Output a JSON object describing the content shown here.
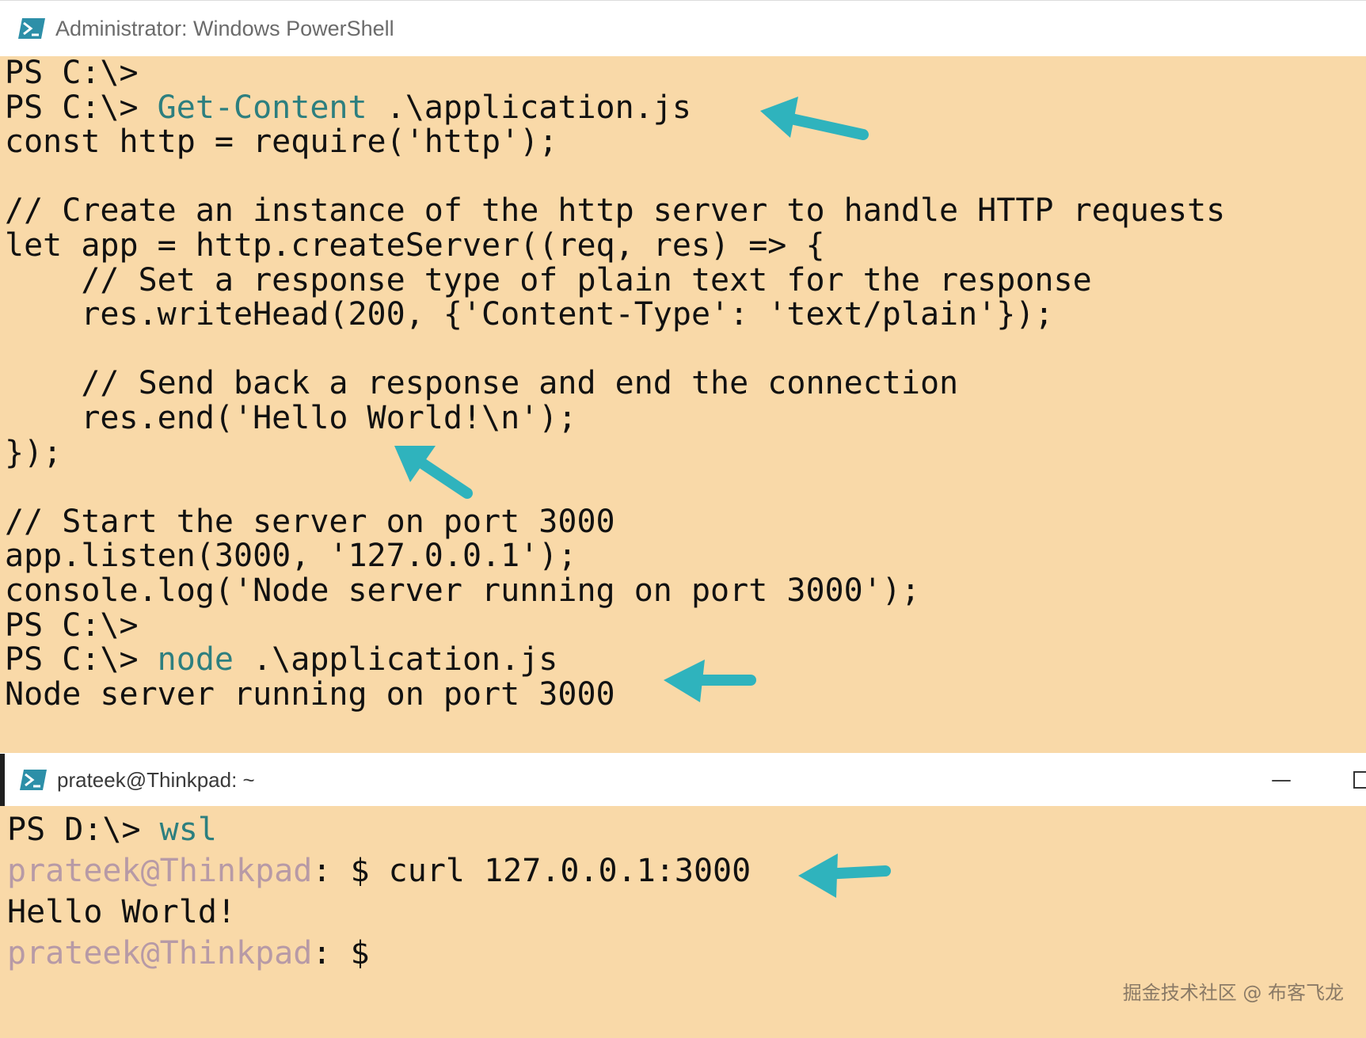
{
  "window1": {
    "title": "Administrator: Windows PowerShell",
    "lines": [
      {
        "prompt": "PS C:\\>",
        "cmd": "",
        "rest": ""
      },
      {
        "prompt": "PS C:\\> ",
        "cmd": "Get-Content",
        "rest": " .\\application.js"
      },
      {
        "text": "const http = require('http');"
      },
      {
        "text": ""
      },
      {
        "text": "// Create an instance of the http server to handle HTTP requests"
      },
      {
        "text": "let app = http.createServer((req, res) => {"
      },
      {
        "text": "    // Set a response type of plain text for the response"
      },
      {
        "text": "    res.writeHead(200, {'Content-Type': 'text/plain'});"
      },
      {
        "text": ""
      },
      {
        "text": "    // Send back a response and end the connection"
      },
      {
        "text": "    res.end('Hello World!\\n');"
      },
      {
        "text": "});"
      },
      {
        "text": ""
      },
      {
        "text": "// Start the server on port 3000"
      },
      {
        "text": "app.listen(3000, '127.0.0.1');"
      },
      {
        "text": "console.log('Node server running on port 3000');"
      },
      {
        "prompt": "PS C:\\>",
        "cmd": "",
        "rest": ""
      },
      {
        "prompt": "PS C:\\> ",
        "cmd": "node",
        "rest": " .\\application.js"
      },
      {
        "text": "Node server running on port 3000"
      }
    ]
  },
  "window2": {
    "title": "prateek@Thinkpad: ~",
    "minimize_glyph": "—",
    "lines": [
      {
        "prompt": "PS D:\\> ",
        "cmd": "wsl"
      },
      {
        "user": "prateek@Thinkpad",
        "sep": ":",
        "tail": " $ curl 127.0.0.1:3000"
      },
      {
        "text": "Hello World!"
      },
      {
        "user": "prateek@Thinkpad",
        "sep": ":",
        "tail": " $"
      }
    ]
  },
  "watermark": "掘金技术社区 @ 布客飞龙",
  "colors": {
    "console_bg": "#f9d9a8",
    "command": "#2d7f7f",
    "wsl_user": "#b79aa6",
    "arrow": "#2fb3bd"
  },
  "icons": [
    "powershell-icon",
    "arrow-annotation-icon"
  ]
}
